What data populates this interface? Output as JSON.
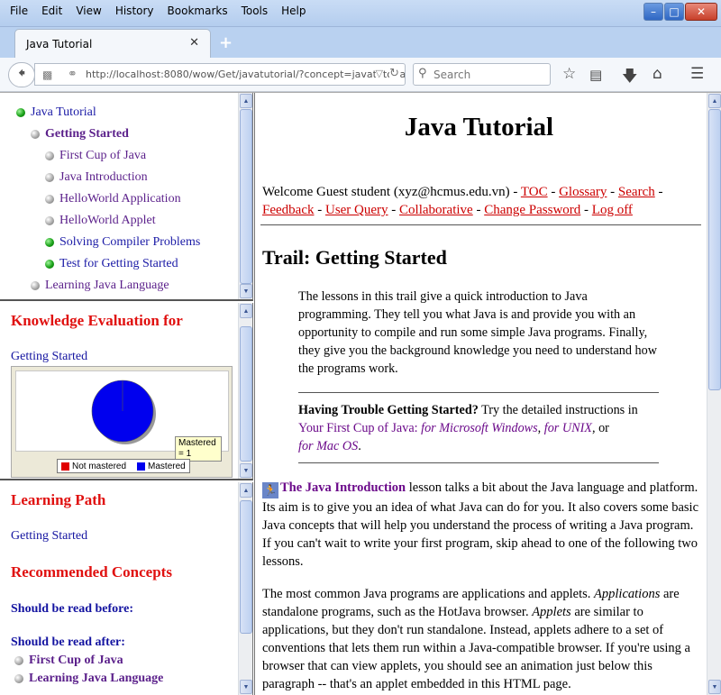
{
  "browser": {
    "menu": [
      "File",
      "Edit",
      "View",
      "History",
      "Bookmarks",
      "Tools",
      "Help"
    ],
    "tab_title": "Java Tutorial",
    "url": "http://localhost:8080/wow/Get/javatutorial/?concept=javatutoria",
    "search_placeholder": "Search"
  },
  "toc": {
    "items": [
      {
        "label": "Java Tutorial",
        "bullet": "green",
        "indent": 0
      },
      {
        "label": "Getting Started",
        "bullet": "silver",
        "indent": 1,
        "bold": true
      },
      {
        "label": "First Cup of Java",
        "bullet": "silver",
        "indent": 2
      },
      {
        "label": "Java Introduction",
        "bullet": "silver",
        "indent": 2
      },
      {
        "label": "HelloWorld Application",
        "bullet": "silver",
        "indent": 2
      },
      {
        "label": "HelloWorld Applet",
        "bullet": "silver",
        "indent": 2
      },
      {
        "label": "Solving Compiler Problems",
        "bullet": "green",
        "indent": 2
      },
      {
        "label": "Test for Getting Started",
        "bullet": "green",
        "indent": 2
      },
      {
        "label": "Learning Java Language",
        "bullet": "silver",
        "indent": 1
      }
    ]
  },
  "evaluation": {
    "heading": "Knowledge Evaluation for",
    "concept": "Getting Started",
    "tooltip_line1": "Mastered",
    "tooltip_line2": "= 1",
    "legend_not": "Not mastered",
    "legend_yes": "Mastered",
    "colors": {
      "not_mastered": "#e00000",
      "mastered": "#0000ee"
    }
  },
  "chart_data": {
    "type": "pie",
    "categories": [
      "Not mastered",
      "Mastered"
    ],
    "values": [
      0,
      1
    ],
    "colors": [
      "#e00000",
      "#0000ee"
    ],
    "legend": "bottom"
  },
  "learning": {
    "path_heading": "Learning Path",
    "path_item": "Getting Started",
    "rec_heading": "Recommended Concepts",
    "before_label": "Should be read before:",
    "after_label": "Should be read after:",
    "after_items": [
      "First Cup of Java",
      "Learning Java Language"
    ]
  },
  "main": {
    "title": "Java Tutorial",
    "welcome": "Welcome Guest student (xyz@hcmus.edu.vn) -",
    "links": [
      "TOC",
      "Glossary",
      "Search",
      "Feedback",
      "User Query",
      "Collaborative",
      "Change Password",
      "Log off"
    ],
    "trail_heading": "Trail: Getting Started",
    "intro": "The lessons in this trail give a quick introduction to Java programming. They tell you what Java is and provide you with an opportunity to compile and run some simple Java programs. Finally, they give you the background knowledge you need to understand how the programs work.",
    "trouble_bold": "Having Trouble Getting Started?",
    "trouble_text": " Try the detailed instructions in",
    "cup_link": "Your First Cup of Java:",
    "win_link": "for Microsoft Windows",
    "unix_link": "for UNIX",
    "or_text": ", or",
    "mac_link": "for Mac OS",
    "java_intro_link": "The Java Introduction",
    "java_intro_text": " lesson talks a bit about the Java language and platform. Its aim is to give you an idea of what Java can do for you. It also covers some basic Java concepts that will help you understand the process of writing a Java program. If you can't wait to write your first program, skip ahead to one of the following two lessons.",
    "p2_a": "The most common Java programs are applications and applets. ",
    "p2_app": "Applications",
    "p2_b": " are standalone programs, such as the HotJava browser. ",
    "p2_applets": "Applets",
    "p2_c": " are similar to applications, but they don't run standalone. Instead, applets adhere to a set of conventions that lets them run within a Java-compatible browser. If you're using a browser that can view applets, you should see an animation just below this paragraph -- that's an applet embedded in this HTML page."
  }
}
